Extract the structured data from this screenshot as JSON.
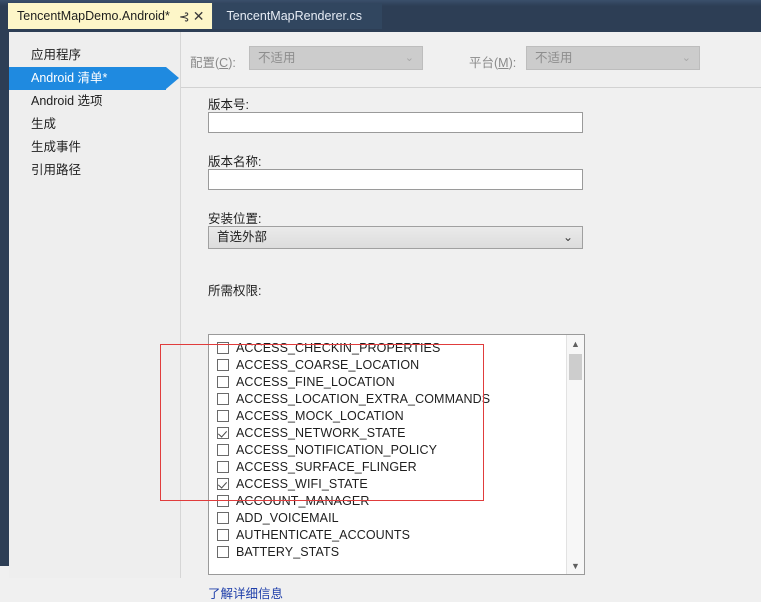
{
  "window": {
    "tabs": [
      {
        "title": "TencentMapDemo.Android*",
        "active": true,
        "pin_icon": "pin-icon",
        "close_icon": "close-icon"
      },
      {
        "title": "TencentMapRenderer.cs",
        "active": false
      }
    ]
  },
  "sidebar": {
    "items": [
      {
        "label": "应用程序",
        "selected": false
      },
      {
        "label": "Android 清单*",
        "selected": true
      },
      {
        "label": "Android 选项",
        "selected": false
      },
      {
        "label": "生成",
        "selected": false
      },
      {
        "label": "生成事件",
        "selected": false
      },
      {
        "label": "引用路径",
        "selected": false
      }
    ]
  },
  "config_row": {
    "configuration_label": "配置(C):",
    "configuration_value": "不适用",
    "platform_label": "平台(M):",
    "platform_value": "不适用",
    "chevron_icon": "chevron-down-icon"
  },
  "form": {
    "version_code_label": "版本号:",
    "version_code_value": "",
    "version_name_label": "版本名称:",
    "version_name_value": "",
    "install_location_label": "安装位置:",
    "install_location_value": "首选外部",
    "permissions_label": "所需权限:",
    "permissions_link": "了解详细信息"
  },
  "permissions": [
    {
      "name": "ACCESS_CHECKIN_PROPERTIES",
      "checked": false
    },
    {
      "name": "ACCESS_COARSE_LOCATION",
      "checked": false
    },
    {
      "name": "ACCESS_FINE_LOCATION",
      "checked": false
    },
    {
      "name": "ACCESS_LOCATION_EXTRA_COMMANDS",
      "checked": false
    },
    {
      "name": "ACCESS_MOCK_LOCATION",
      "checked": false
    },
    {
      "name": "ACCESS_NETWORK_STATE",
      "checked": true
    },
    {
      "name": "ACCESS_NOTIFICATION_POLICY",
      "checked": false
    },
    {
      "name": "ACCESS_SURFACE_FLINGER",
      "checked": false
    },
    {
      "name": "ACCESS_WIFI_STATE",
      "checked": true
    },
    {
      "name": "ACCOUNT_MANAGER",
      "checked": false
    },
    {
      "name": "ADD_VOICEMAIL",
      "checked": false
    },
    {
      "name": "AUTHENTICATE_ACCOUNTS",
      "checked": false
    },
    {
      "name": "BATTERY_STATS",
      "checked": false
    }
  ],
  "scrollbar": {
    "up_icon": "chevron-up-icon",
    "down_icon": "chevron-down-icon"
  },
  "annotation": {
    "color": "#e03c3c"
  },
  "colors": {
    "accent": "#1f8ae0",
    "tab_active_bg": "#fdf6c8",
    "ide_dark": "#2d3e55",
    "link": "#1f3faa"
  }
}
